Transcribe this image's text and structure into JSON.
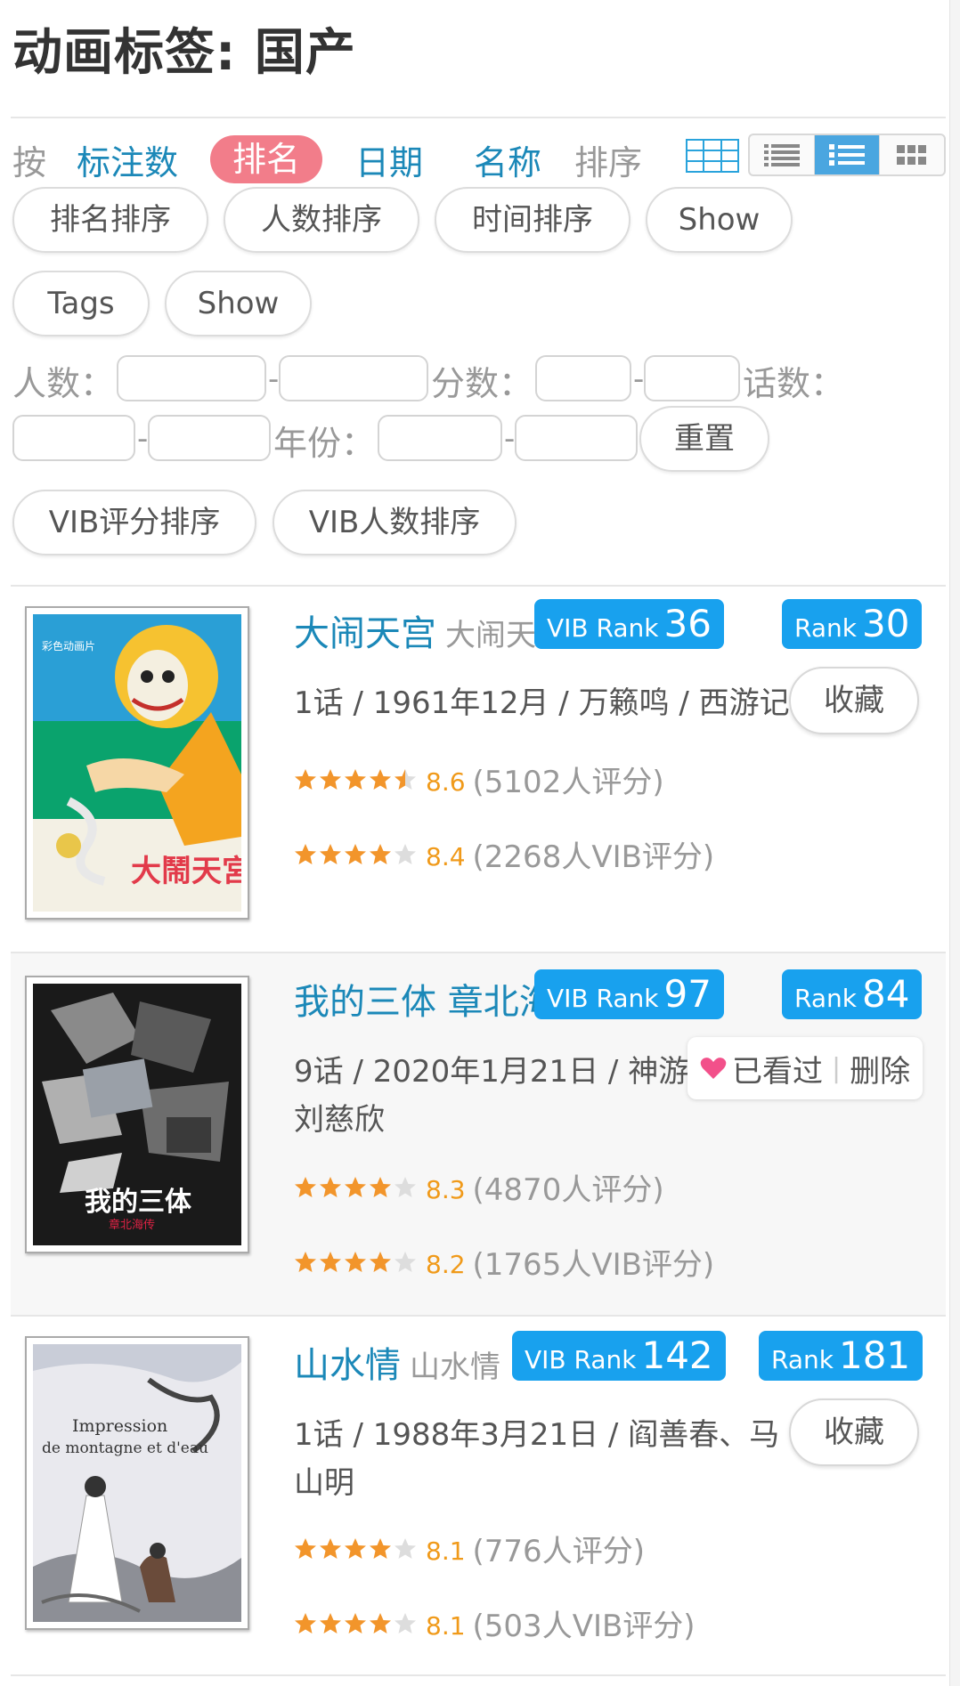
{
  "page": {
    "title": "动画标签: 国产"
  },
  "sort": {
    "prefix": "按",
    "options": [
      "标注数",
      "排名",
      "日期",
      "名称"
    ],
    "active": "排名",
    "suffix": "排序"
  },
  "pills_row1": [
    "排名排序",
    "人数排序",
    "时间排序",
    "Show"
  ],
  "pills_row2": [
    "Tags",
    "Show"
  ],
  "filters": {
    "count_label": "人数：",
    "score_label": "分数：",
    "episodes_label": "话数：",
    "year_label": "年份：",
    "separator": "-",
    "reset": "重置"
  },
  "pills_row3": [
    "VIB评分排序",
    "VIB人数排序"
  ],
  "view_modes": [
    "list-compact-icon",
    "list-detail-icon",
    "grid-icon"
  ],
  "accent_color": "#18a1ee",
  "items": [
    {
      "title": "大闹天宫",
      "subtitle": "大闹天",
      "vib_label": "VIB Rank",
      "vib_rank": "36",
      "rank_label": "Rank",
      "rank": "30",
      "info_line1": "1话 / 1961年12月 / 万籁鸣 / 西游记",
      "info_line2": "",
      "score": "8.6",
      "score_stars": 4.5,
      "score_count": "(5102人评分)",
      "vib_score": "8.4",
      "vib_stars": 4,
      "vib_count": "(2268人VIB评分)",
      "action": "收藏"
    },
    {
      "title": "我的三体 章北海",
      "subtitle": "",
      "vib_label": "VIB Rank",
      "vib_rank": "97",
      "rank_label": "Rank",
      "rank": "84",
      "info_line1": "9话 / 2020年1月21日 / 神游",
      "info_line2": "刘慈欣",
      "score": "8.3",
      "score_stars": 4,
      "score_count": "(4870人评分)",
      "vib_score": "8.2",
      "vib_stars": 4,
      "vib_count": "(1765人VIB评分)",
      "watched_label": "已看过",
      "delete_label": "删除"
    },
    {
      "title": "山水情",
      "subtitle": "山水情",
      "vib_label": "VIB Rank",
      "vib_rank": "142",
      "rank_label": "Rank",
      "rank": "181",
      "info_line1": "1话 / 1988年3月21日 / 阎善春、马",
      "info_line2": "山明",
      "score": "8.1",
      "score_stars": 4,
      "score_count": "(776人评分)",
      "vib_score": "8.1",
      "vib_stars": 4,
      "vib_count": "(503人VIB评分)",
      "action": "收藏",
      "cover_text_1": "Impression",
      "cover_text_2": "de montagne et d'eau"
    }
  ]
}
